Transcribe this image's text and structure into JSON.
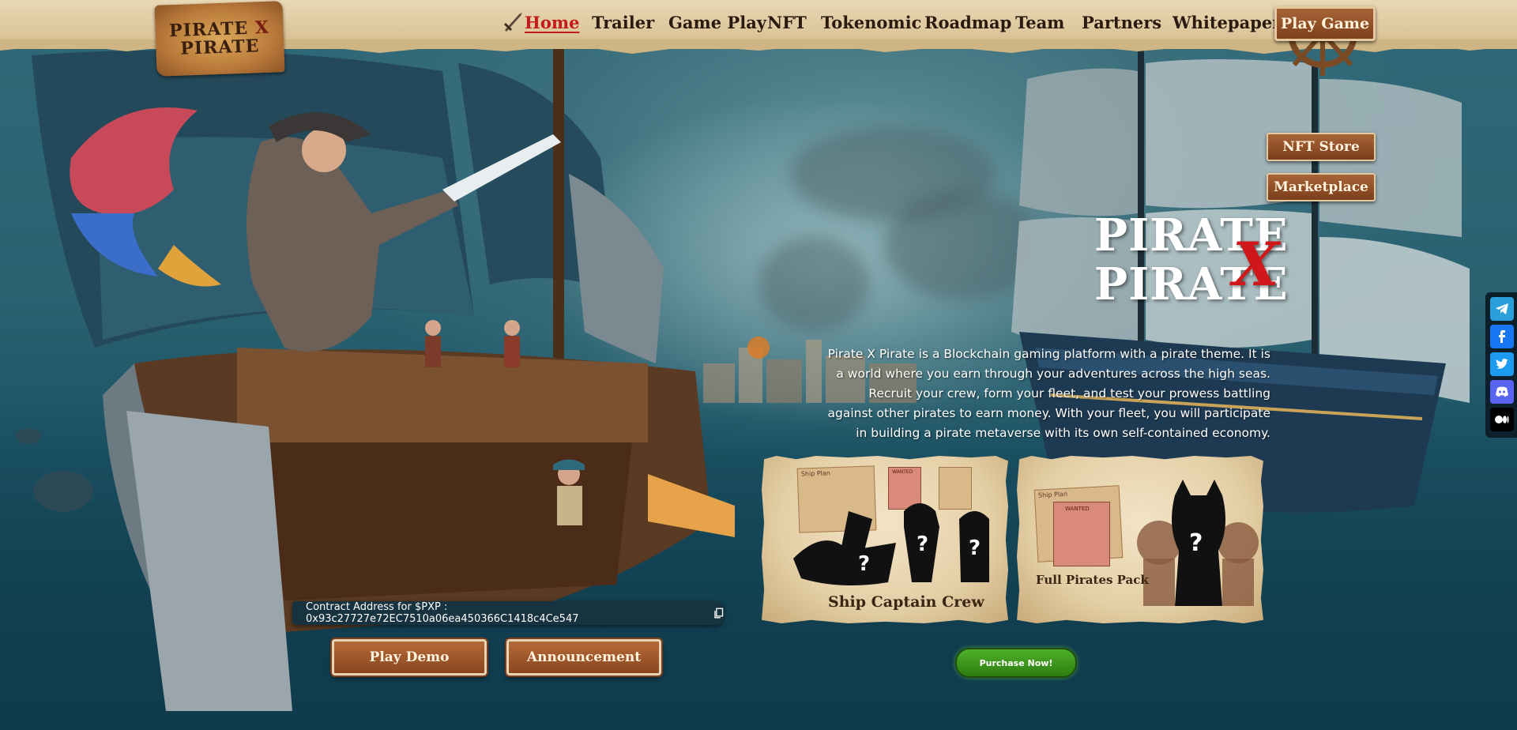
{
  "brand": {
    "logo_line1": "PIRATE",
    "logo_x": "X",
    "logo_line2": "PIRATE"
  },
  "nav": {
    "items": [
      {
        "label": "Home"
      },
      {
        "label": "Trailer"
      },
      {
        "label": "Game Play"
      },
      {
        "label": "NFT"
      },
      {
        "label": "Tokenomic"
      },
      {
        "label": "Roadmap"
      },
      {
        "label": "Team"
      },
      {
        "label": "Partners"
      },
      {
        "label": "Whitepaper"
      }
    ],
    "cta_label": "Play Game"
  },
  "side_buttons": {
    "nft_store": "NFT Store",
    "marketplace": "Marketplace"
  },
  "hero": {
    "title_line1": "PIRATE",
    "title_x": "X",
    "title_line2": "PIRATE",
    "description": "Pirate X Pirate is a Blockchain gaming platform with a pirate theme. It is a world where you earn through your adventures across the high seas. Recruit your crew, form your fleet, and test your prowess battling against other pirates to earn money. With your fleet, you will participate in building a pirate metaverse with its own self-contained economy."
  },
  "cards": [
    {
      "label": "Ship Captain Crew",
      "paper_text": "Ship Plan",
      "poster_text": "WANTED"
    },
    {
      "label": "Full Pirates Pack",
      "paper_text": "Ship Plan",
      "poster_text": "WANTED"
    }
  ],
  "purchase_label": "Purchase Now!",
  "contract": {
    "text": "Contract Address for $PXP : 0x93c27727e72EC7510a06ea450366C1418c4Ce547"
  },
  "bottom_buttons": {
    "play_demo": "Play Demo",
    "announcement": "Announcement"
  },
  "social": [
    "telegram-icon",
    "facebook-icon",
    "twitter-icon",
    "discord-icon",
    "medium-icon"
  ],
  "colors": {
    "accent_red": "#c41a1a",
    "button_brown": "#8a461f",
    "purchase_green": "#3a9a1c",
    "header_parchment": "#e0cba2"
  }
}
